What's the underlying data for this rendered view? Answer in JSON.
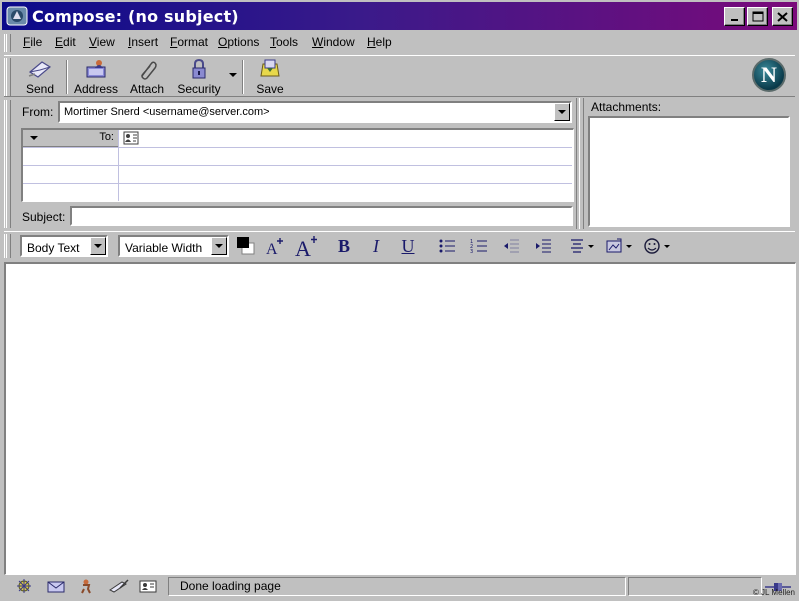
{
  "window": {
    "title": "Compose: (no subject)"
  },
  "menu": [
    {
      "label": "File",
      "key": "F",
      "rest": "ile"
    },
    {
      "label": "Edit",
      "key": "E",
      "rest": "dit"
    },
    {
      "label": "View",
      "key": "V",
      "rest": "iew"
    },
    {
      "label": "Insert",
      "key": "I",
      "rest": "nsert"
    },
    {
      "label": "Format",
      "key": "F",
      "rest": "ormat",
      "pre": ""
    },
    {
      "label": "Options",
      "key": "O",
      "rest": "ptions"
    },
    {
      "label": "Tools",
      "key": "T",
      "rest": "ools"
    },
    {
      "label": "Window",
      "key": "W",
      "rest": "indow"
    },
    {
      "label": "Help",
      "key": "H",
      "rest": "elp"
    }
  ],
  "toolbar": {
    "send": "Send",
    "address": "Address",
    "attach": "Attach",
    "security": "Security",
    "save": "Save"
  },
  "logo": "N",
  "header": {
    "from_label": "From:",
    "from_value": "Mortimer Snerd <username@server.com>",
    "to_label": "To:",
    "subject_label": "Subject:",
    "subject_value": "",
    "attachments_label": "Attachments:"
  },
  "format": {
    "paragraph_style": "Body Text",
    "font": "Variable Width",
    "bold": "B",
    "italic": "I",
    "underline": "U"
  },
  "status": {
    "text": "Done loading page",
    "copyright": "© JL Mellen"
  },
  "colors": {
    "title_start": "#0a0a8a",
    "title_end": "#7a0a7a",
    "chrome": "#c0c0c0",
    "text_color_swatch": "#000000"
  }
}
